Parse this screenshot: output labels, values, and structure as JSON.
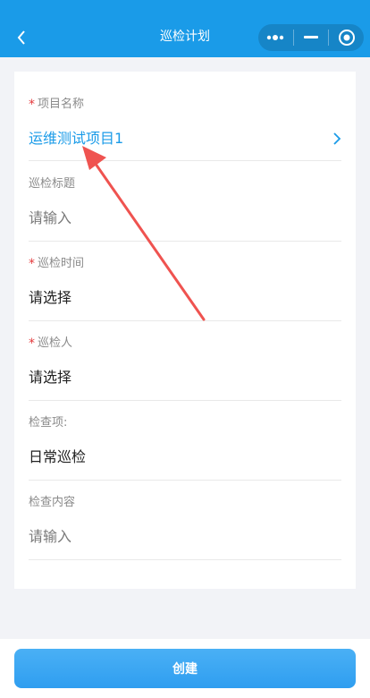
{
  "header": {
    "title": "巡检计划",
    "back_icon": "chevron-left-icon",
    "capsule_icons": [
      "more-dots-icon",
      "minimize-icon",
      "close-target-icon"
    ]
  },
  "form": {
    "project": {
      "label": "项目名称",
      "required": true,
      "value": "运维测试项目1",
      "icon": "chevron-right-icon"
    },
    "title": {
      "label": "巡检标题",
      "required": false,
      "placeholder": "请输入"
    },
    "time": {
      "label": "巡检时间",
      "required": true,
      "placeholder": "请选择"
    },
    "inspector": {
      "label": "巡检人",
      "required": true,
      "placeholder": "请选择"
    },
    "items": {
      "label": "检查项:",
      "required": false,
      "value": "日常巡检"
    },
    "content": {
      "label": "检查内容",
      "required": false,
      "placeholder": "请输入"
    }
  },
  "required_mark": "*",
  "footer": {
    "create_label": "创建"
  },
  "colors": {
    "nav": "#1a9be8",
    "accent": "#1a9be8",
    "required": "#e4393c",
    "annotation_arrow": "#ef5350"
  }
}
